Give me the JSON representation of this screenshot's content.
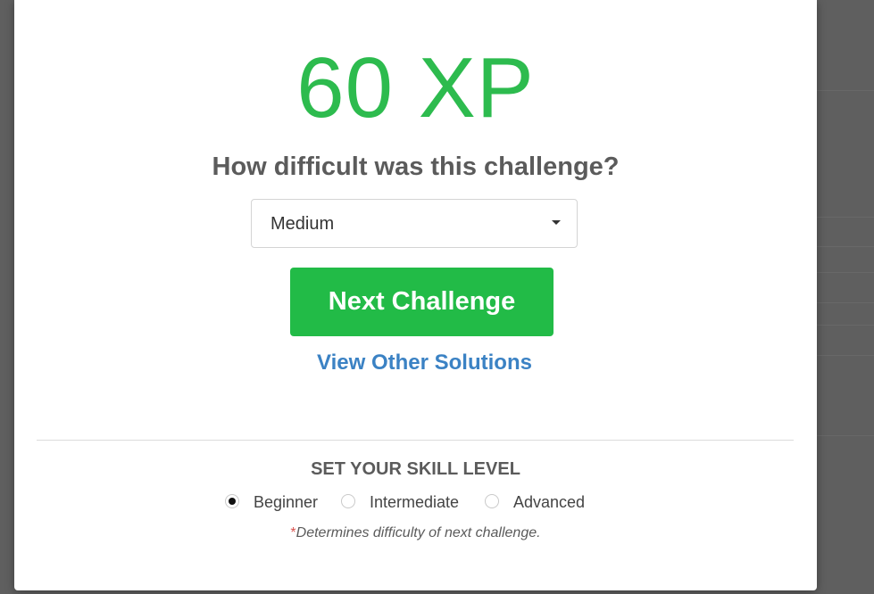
{
  "result": {
    "xp_text": "60 XP",
    "xp_color": "#2dbb4e"
  },
  "difficulty": {
    "question": "How difficult was this challenge?",
    "selected": "Medium"
  },
  "actions": {
    "next_label": "Next Challenge",
    "next_color": "#22bb47",
    "view_label": "View Other Solutions",
    "view_color": "#3b82c4"
  },
  "skill": {
    "title": "SET YOUR SKILL LEVEL",
    "options": [
      {
        "label": "Beginner",
        "checked": true
      },
      {
        "label": "Intermediate",
        "checked": false
      },
      {
        "label": "Advanced",
        "checked": false
      }
    ],
    "note_marker": "*",
    "note_text": "Determines difficulty of next challenge."
  }
}
